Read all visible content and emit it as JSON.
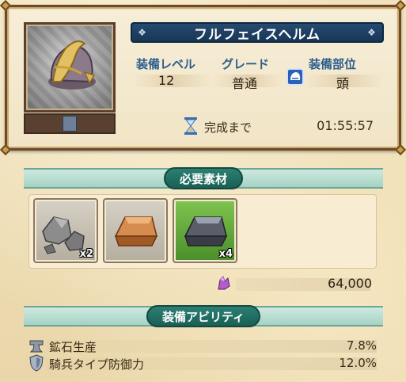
{
  "item": {
    "name": "フルフェイスヘルム",
    "icon": "helmet-icon"
  },
  "stats": {
    "level_label": "装備レベル",
    "level_value": "12",
    "grade_label": "グレード",
    "grade_value": "普通",
    "part_label": "装備部位",
    "part_value": "頭",
    "part_icon": "helmet-part-icon"
  },
  "timer": {
    "label": "完成まで",
    "value": "01:55:57",
    "icon": "hourglass-icon"
  },
  "materials": {
    "title": "必要素材",
    "items": [
      {
        "icon": "ore-rocks-icon",
        "qty": "x2"
      },
      {
        "icon": "copper-ingot-icon",
        "qty": ""
      },
      {
        "icon": "iron-ingot-icon",
        "qty": "x4"
      }
    ],
    "cost_icon": "crystal-icon",
    "cost": "64,000"
  },
  "abilities": {
    "title": "装備アビリティ",
    "items": [
      {
        "name": "鉱石生産",
        "value": "7.8%",
        "icon": "anvil-icon"
      },
      {
        "name": "騎兵タイプ防御力",
        "value": "12.0%",
        "icon": "shield-icon"
      }
    ]
  },
  "colors": {
    "banner": "#1f4063",
    "section": "#1a5f55",
    "label_blue": "#2c5e8c",
    "selected_material_bg": "#5fae3c"
  }
}
